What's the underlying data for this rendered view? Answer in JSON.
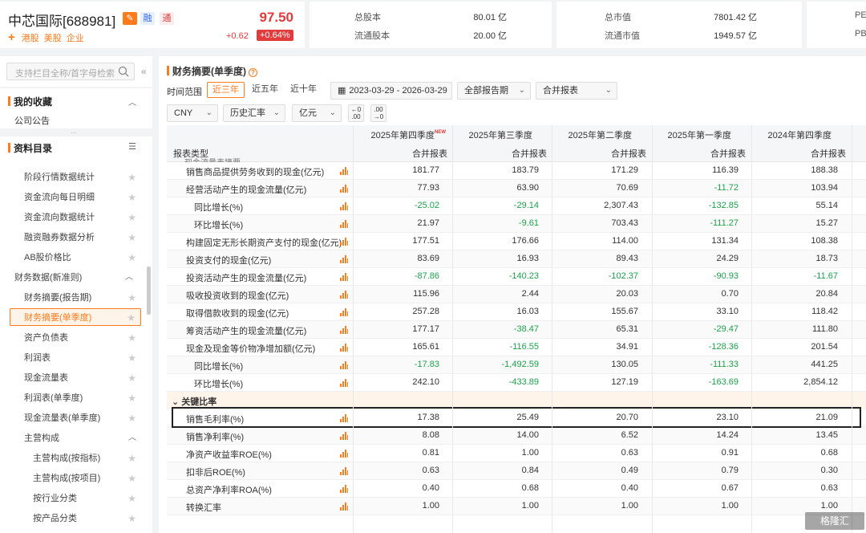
{
  "stock": {
    "name": "中芯国际[688981]",
    "tag_rong": "融",
    "tag_tong": "通",
    "price": "97.50",
    "change": "+0.62",
    "change_pct": "+0.64%",
    "markets": [
      "港股",
      "美股",
      "企业"
    ]
  },
  "stats": [
    {
      "label": "总股本",
      "value": "80.01 亿"
    },
    {
      "label": "流通股本",
      "value": "20.00 亿"
    },
    {
      "label": "总市值",
      "value": "7801.42 亿"
    },
    {
      "label": "流通市值",
      "value": "1949.57 亿"
    },
    {
      "label": "PE",
      "value": ""
    },
    {
      "label": "PB",
      "value": ""
    }
  ],
  "sidebar": {
    "search_placeholder": "支持栏目全称/首字母检索",
    "favorites_title": "我的收藏",
    "favorites": [
      "公司公告"
    ],
    "catalog_title": "资料目录",
    "items": [
      {
        "label": "阶段行情数据统计",
        "level": 1
      },
      {
        "label": "资金流向每日明细",
        "level": 1
      },
      {
        "label": "资金流向数据统计",
        "level": 1
      },
      {
        "label": "融资融券数据分析",
        "level": 1
      },
      {
        "label": "AB股价格比",
        "level": 1
      },
      {
        "label": "财务数据(新准则)",
        "level": 0,
        "group": true
      },
      {
        "label": "财务摘要(报告期)",
        "level": 1
      },
      {
        "label": "财务摘要(单季度)",
        "level": 1,
        "active": true
      },
      {
        "label": "资产负债表",
        "level": 1
      },
      {
        "label": "利润表",
        "level": 1
      },
      {
        "label": "现金流量表",
        "level": 1
      },
      {
        "label": "利润表(单季度)",
        "level": 1
      },
      {
        "label": "现金流量表(单季度)",
        "level": 1
      },
      {
        "label": "主营构成",
        "level": 1,
        "group": true
      },
      {
        "label": "主营构成(按指标)",
        "level": 2
      },
      {
        "label": "主营构成(按项目)",
        "level": 2
      },
      {
        "label": "按行业分类",
        "level": 2
      },
      {
        "label": "按产品分类",
        "level": 2
      }
    ]
  },
  "main": {
    "title": "财务摘要(单季度)",
    "range_label": "时间范围",
    "ranges": [
      "近三年",
      "近五年",
      "近十年"
    ],
    "date_range": "2023-03-29 - 2026-03-29",
    "period_select": "全部报告期",
    "report_select": "合并报表",
    "currency": "CNY",
    "fx": "历史汇率",
    "unit": "亿元",
    "unit_btn1": "←0 .00",
    "unit_btn2": ".00 →0"
  },
  "table": {
    "type_header": "报表类型",
    "columns": [
      {
        "period": "2025年第四季度",
        "new": "NEW",
        "type": "合并报表"
      },
      {
        "period": "2025年第三季度",
        "new": "",
        "type": "合并报表"
      },
      {
        "period": "2025年第二季度",
        "new": "",
        "type": "合并报表"
      },
      {
        "period": "2025年第一季度",
        "new": "",
        "type": "合并报表"
      },
      {
        "period": "2024年第四季度",
        "new": "",
        "type": "合并报表"
      }
    ],
    "partial_header": "现金流量表摘要",
    "rows": [
      {
        "label": "销售商品提供劳务收到的现金(亿元)",
        "indent": false,
        "values": [
          "181.77",
          "183.79",
          "171.29",
          "116.39",
          "188.38"
        ]
      },
      {
        "label": "经营活动产生的现金流量(亿元)",
        "indent": false,
        "values": [
          "77.93",
          "63.90",
          "70.69",
          "-11.72",
          "103.94"
        ]
      },
      {
        "label": "同比增长(%)",
        "indent": true,
        "values": [
          "-25.02",
          "-29.14",
          "2,307.43",
          "-132.85",
          "55.14"
        ]
      },
      {
        "label": "环比增长(%)",
        "indent": true,
        "values": [
          "21.97",
          "-9.61",
          "703.43",
          "-111.27",
          "15.27"
        ]
      },
      {
        "label": "构建固定无形长期资产支付的现金(亿元)",
        "indent": false,
        "values": [
          "177.51",
          "176.66",
          "114.00",
          "131.34",
          "108.38"
        ]
      },
      {
        "label": "投资支付的现金(亿元)",
        "indent": false,
        "values": [
          "83.69",
          "16.93",
          "89.43",
          "24.29",
          "18.73"
        ]
      },
      {
        "label": "投资活动产生的现金流量(亿元)",
        "indent": false,
        "values": [
          "-87.86",
          "-140.23",
          "-102.37",
          "-90.93",
          "-11.67"
        ]
      },
      {
        "label": "吸收投资收到的现金(亿元)",
        "indent": false,
        "values": [
          "115.96",
          "2.44",
          "20.03",
          "0.70",
          "20.84"
        ]
      },
      {
        "label": "取得借款收到的现金(亿元)",
        "indent": false,
        "values": [
          "257.28",
          "16.03",
          "155.67",
          "33.10",
          "118.42"
        ]
      },
      {
        "label": "筹资活动产生的现金流量(亿元)",
        "indent": false,
        "values": [
          "177.17",
          "-38.47",
          "65.31",
          "-29.47",
          "111.80"
        ]
      },
      {
        "label": "现金及现金等价物净增加额(亿元)",
        "indent": false,
        "values": [
          "165.61",
          "-116.55",
          "34.91",
          "-128.36",
          "201.54"
        ]
      },
      {
        "label": "同比增长(%)",
        "indent": true,
        "values": [
          "-17.83",
          "-1,492.59",
          "130.05",
          "-111.33",
          "441.25"
        ]
      },
      {
        "label": "环比增长(%)",
        "indent": true,
        "values": [
          "242.10",
          "-433.89",
          "127.19",
          "-163.69",
          "2,854.12"
        ]
      }
    ],
    "section_title": "关键比率",
    "ratio_rows": [
      {
        "label": "销售毛利率(%)",
        "values": [
          "17.38",
          "25.49",
          "20.70",
          "23.10",
          "21.09"
        ]
      },
      {
        "label": "销售净利率(%)",
        "values": [
          "8.08",
          "14.00",
          "6.52",
          "14.24",
          "13.45"
        ]
      },
      {
        "label": "净资产收益率ROE(%)",
        "values": [
          "0.81",
          "1.00",
          "0.63",
          "0.91",
          "0.68"
        ]
      },
      {
        "label": "扣非后ROE(%)",
        "values": [
          "0.63",
          "0.84",
          "0.49",
          "0.79",
          "0.30"
        ]
      },
      {
        "label": "总资产净利率ROA(%)",
        "values": [
          "0.40",
          "0.68",
          "0.40",
          "0.67",
          "0.63"
        ]
      },
      {
        "label": "转换汇率",
        "values": [
          "1.00",
          "1.00",
          "1.00",
          "1.00",
          "1.00"
        ]
      }
    ]
  },
  "watermark": "格隆汇",
  "colors": {
    "accent": "#ff7a1a",
    "up": "#e23b3b",
    "down": "#1aa34a"
  }
}
